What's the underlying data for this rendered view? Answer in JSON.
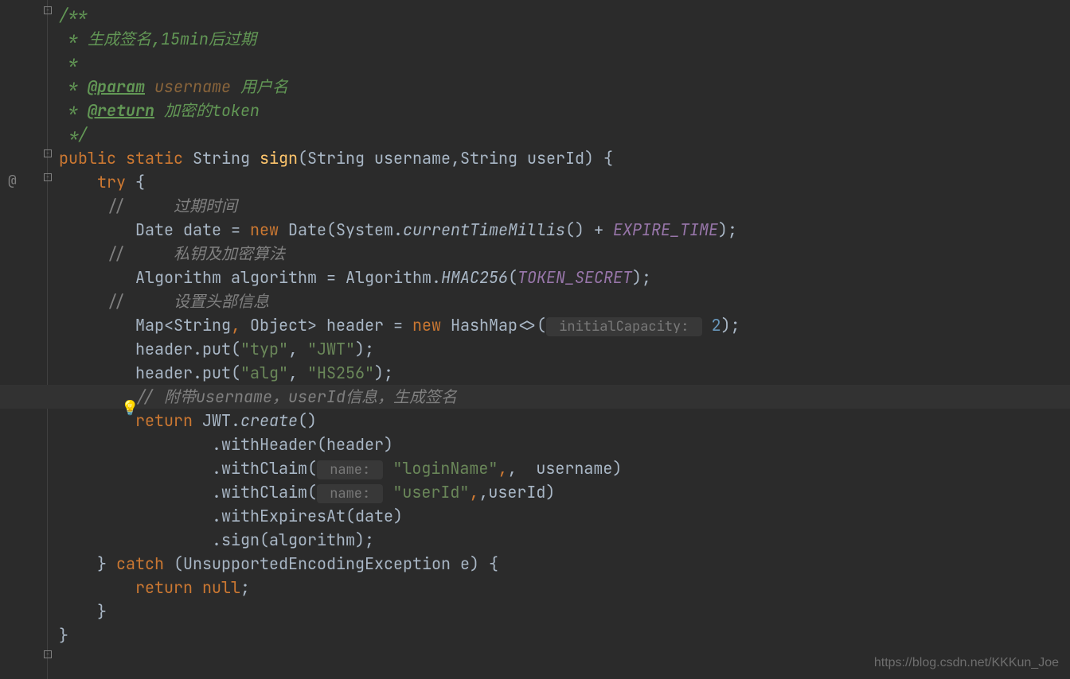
{
  "code": {
    "doc1": "/**",
    "doc2": " * 生成签名,15min后过期",
    "doc3": " *",
    "doc4_prefix": " * ",
    "doc4_tag": "@param",
    "doc4_param": " username",
    "doc4_rest": " 用户名",
    "doc5_prefix": " * ",
    "doc5_tag": "@return",
    "doc5_rest": " 加密的token",
    "doc6": " */",
    "kw_public": "public",
    "kw_static": "static",
    "type_string": "String",
    "method_sign": "sign",
    "sig_params": "(String username,String userId) {",
    "kw_try": "try",
    "try_brace": " {",
    "slash": "//",
    "cmt_expire": "过期时间",
    "line_date_pre": "Date date = ",
    "kw_new": "new",
    "date_mid": " Date(System.",
    "currentTimeMillis": "currentTimeMillis",
    "date_after": "() + ",
    "const_expire": "EXPIRE_TIME",
    "date_end": ");",
    "cmt_algo": "私钥及加密算法",
    "algo_pre": "Algorithm algorithm = Algorithm.",
    "hmac": "HMAC256",
    "algo_open": "(",
    "const_secret": "TOKEN_SECRET",
    "algo_end": ");",
    "cmt_header": "设置头部信息",
    "map_pre": "Map<String",
    "comma": ",",
    "map_mid": " Object> header = ",
    "hashmap": " HashMap<>(",
    "hint_capacity": " initialCapacity: ",
    "cap_val": "2",
    "map_end": ");",
    "put1_pre": "header.put(",
    "str_typ": "\"typ\"",
    "put1_mid": ", ",
    "str_jwt": "\"JWT\"",
    "put1_end": ");",
    "put2_pre": "header.put(",
    "str_alg": "\"alg\"",
    "put2_mid": ", ",
    "str_hs256": "\"HS256\"",
    "put2_end": ");",
    "cmt_attach": "// 附带username，userId信息，生成签名",
    "kw_return": "return",
    "jwt_pre": " JWT.",
    "create": "create",
    "jwt_end": "()",
    "withHeader": ".withHeader(header)",
    "withClaim1_pre": ".withClaim(",
    "hint_name": " name: ",
    "str_login": "\"loginName\"",
    "withClaim1_end": ",  username)",
    "withClaim2_pre": ".withClaim(",
    "str_userid": "\"userId\"",
    "withClaim2_end": ",userId)",
    "withExpires": ".withExpiresAt(date)",
    "sign_call": ".sign(algorithm);",
    "catch_pre": "} ",
    "kw_catch": "catch",
    "catch_rest": " (UnsupportedEncodingException e) {",
    "kw_return2": "return",
    "kw_null": "null",
    "semi": ";",
    "close_brace1": "}",
    "close_brace2": "}"
  },
  "watermark": "https://blog.csdn.net/KKKun_Joe"
}
